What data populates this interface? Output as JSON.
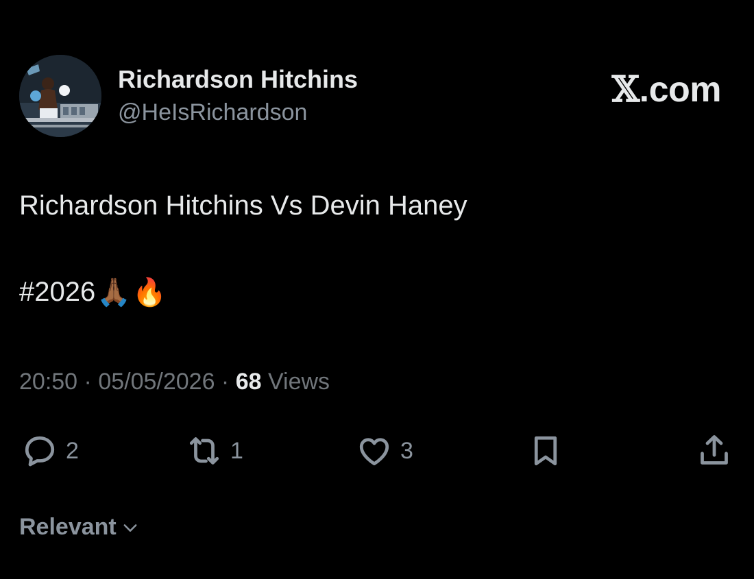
{
  "author": {
    "display_name": "Richardson Hitchins",
    "handle": "@HeIsRichardson",
    "avatar_icon": "boxer-photo-avatar"
  },
  "brand": {
    "label": ".com",
    "logo_glyph": "𝕏"
  },
  "post": {
    "text": "Richardson Hitchins Vs Devin Haney",
    "hashtag": "#2026",
    "emojis": [
      "🙏🏾",
      "🔥"
    ]
  },
  "meta": {
    "time": "20:50",
    "separator": " · ",
    "date": "05/05/2026",
    "views_count": "68",
    "views_label": " Views"
  },
  "actions": {
    "reply": {
      "icon": "reply-bubble-icon",
      "count": "2"
    },
    "repost": {
      "icon": "repost-arrows-icon",
      "count": "1"
    },
    "like": {
      "icon": "heart-icon",
      "count": "3"
    },
    "bookmark": {
      "icon": "bookmark-icon"
    },
    "share": {
      "icon": "share-upload-icon"
    }
  },
  "sort": {
    "label": "Relevant",
    "icon": "chevron-down-icon"
  },
  "colors": {
    "background": "#000000",
    "primary_text": "#e7e9ea",
    "secondary_text": "#71767b"
  }
}
